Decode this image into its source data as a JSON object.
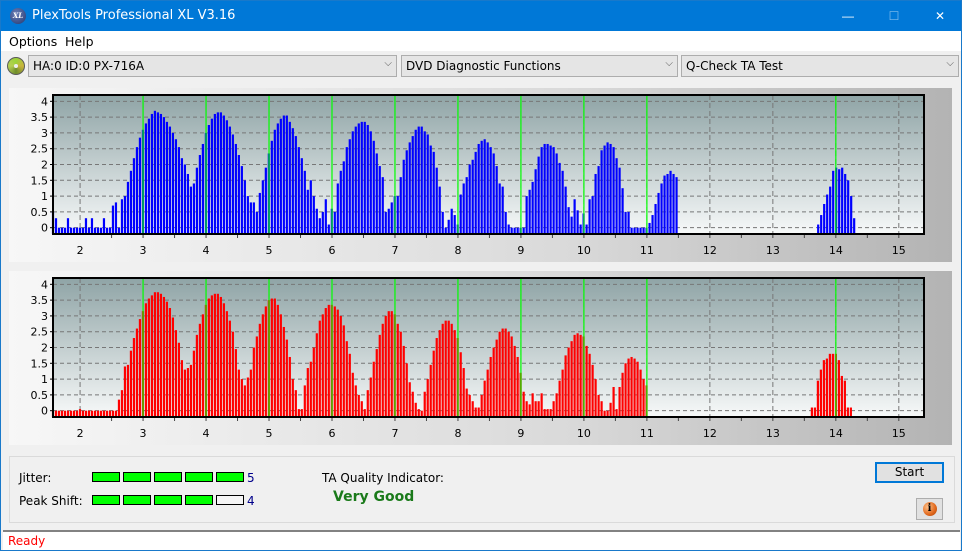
{
  "window": {
    "title": "PlexTools Professional XL V3.16",
    "app_icon_text": "XL",
    "controls": {
      "minimize": "—",
      "maximize": "☐",
      "close": "✕"
    }
  },
  "menu": {
    "items": [
      "Options",
      "Help"
    ]
  },
  "toolbar": {
    "drive": "HA:0 ID:0  PX-716A",
    "function": "DVD Diagnostic Functions",
    "test": "Q-Check TA Test",
    "chevron": "⌵"
  },
  "colors": {
    "jitter_bar": "#0000ff",
    "peak_bar": "#ff0000",
    "marker": "#00ff00",
    "meter_on": "#00ff00",
    "quality": "#1a7a1a",
    "status": "#ff0000"
  },
  "chart_data": [
    {
      "type": "bar",
      "name": "top-chart",
      "title": "",
      "xlabel": "",
      "ylabel": "",
      "xlim": [
        1.57,
        15.4
      ],
      "ylim": [
        -0.2,
        4.2
      ],
      "x_ticks": [
        2,
        3,
        4,
        5,
        6,
        7,
        8,
        9,
        10,
        11,
        12,
        13,
        14,
        15
      ],
      "y_ticks": [
        0,
        0.5,
        1,
        1.5,
        2,
        2.5,
        3,
        3.5,
        4
      ],
      "y_tick_labels": [
        "0",
        "0.5",
        "1",
        "1.5",
        "2",
        "2.5",
        "3",
        "3.5",
        "4"
      ],
      "grid": true,
      "marker_lines_x": [
        3,
        4,
        5,
        6,
        7,
        8,
        9,
        10,
        11,
        14
      ],
      "bar_x_start": 1.57,
      "bar_x_step": 0.0476,
      "color": "#0000ff",
      "values": [
        0.5,
        0.3,
        0,
        0,
        0,
        0.3,
        0,
        0,
        0,
        0,
        0,
        0.3,
        0,
        0.3,
        0,
        0,
        0,
        0.3,
        0,
        0,
        0.7,
        0.8,
        0,
        0.9,
        1.0,
        1.45,
        1.8,
        2.2,
        2.55,
        2.85,
        3.1,
        3.3,
        3.45,
        3.6,
        3.7,
        3.65,
        3.6,
        3.5,
        3.35,
        3.2,
        3.0,
        2.8,
        2.55,
        2.2,
        2.0,
        1.7,
        1.3,
        1.4,
        1.9,
        2.3,
        2.65,
        3.0,
        3.25,
        3.45,
        3.6,
        3.65,
        3.65,
        3.55,
        3.4,
        3.2,
        2.95,
        2.65,
        2.3,
        1.95,
        1.5,
        1.0,
        0.8,
        0.8,
        0.5,
        1.1,
        1.5,
        1.9,
        2.35,
        2.75,
        3.1,
        3.3,
        3.45,
        3.55,
        3.55,
        3.35,
        3.15,
        2.9,
        2.55,
        2.2,
        1.8,
        1.2,
        1.5,
        1.0,
        0.6,
        0.3,
        0.5,
        0.9,
        0.1,
        0.6,
        0.5,
        1.4,
        1.8,
        2.1,
        2.55,
        2.8,
        3.05,
        3.2,
        3.3,
        3.35,
        3.35,
        3.25,
        3.05,
        2.75,
        2.35,
        1.95,
        1.6,
        0.5,
        0.6,
        0.8,
        1.0,
        1.0,
        1.6,
        2.15,
        2.45,
        2.7,
        2.9,
        3.1,
        3.2,
        3.2,
        3.05,
        2.95,
        2.6,
        2.4,
        1.9,
        1.3,
        0.5,
        0,
        0.25,
        0.6,
        0.4,
        0.1,
        1.05,
        1.4,
        1.6,
        2.0,
        2.15,
        2.4,
        2.65,
        2.75,
        2.8,
        2.7,
        2.55,
        2.35,
        1.95,
        1.4,
        1.3,
        0.5,
        0.1,
        0,
        0,
        0,
        0,
        0,
        1.0,
        1.2,
        1.45,
        1.85,
        2.25,
        2.55,
        2.65,
        2.65,
        2.6,
        2.55,
        2.35,
        2.05,
        1.8,
        1.3,
        0.65,
        0.35,
        0.9,
        0.55,
        0.1,
        0.45,
        0.1,
        0.9,
        1.0,
        1.7,
        1.95,
        2.45,
        2.6,
        2.7,
        2.65,
        2.55,
        2.2,
        1.9,
        1.25,
        0.5,
        0.5,
        0,
        0,
        0,
        0,
        0,
        0,
        0.15,
        0.4,
        0.75,
        1.1,
        1.4,
        1.65,
        1.7,
        1.8,
        1.7,
        1.6,
        1.4,
        0.7,
        0.1
      ]
    },
    {
      "type": "bar",
      "name": "bottom-chart",
      "title": "",
      "xlabel": "",
      "ylabel": "",
      "xlim": [
        1.57,
        15.4
      ],
      "ylim": [
        -0.2,
        4.2
      ],
      "x_ticks": [
        2,
        3,
        4,
        5,
        6,
        7,
        8,
        9,
        10,
        11,
        12,
        13,
        14,
        15
      ],
      "y_ticks": [
        0,
        0.5,
        1,
        1.5,
        2,
        2.5,
        3,
        3.5,
        4
      ],
      "y_tick_labels": [
        "0",
        "0.5",
        "1",
        "1.5",
        "2",
        "2.5",
        "3",
        "3.5",
        "4"
      ],
      "grid": true,
      "marker_lines_x": [
        3,
        4,
        5,
        6,
        7,
        8,
        9,
        10,
        11,
        14
      ],
      "bar_x_start": 1.57,
      "bar_x_step": 0.0476,
      "color": "#ff0000",
      "values": [
        0,
        0,
        0,
        0,
        0,
        0,
        0,
        0,
        0,
        0.05,
        0,
        0,
        0,
        0,
        0,
        0,
        0,
        0,
        0,
        0,
        0,
        0,
        0.35,
        0.65,
        1.4,
        1.45,
        1.9,
        2.3,
        2.6,
        2.9,
        3.15,
        3.4,
        3.55,
        3.65,
        3.75,
        3.75,
        3.7,
        3.6,
        3.45,
        3.25,
        2.95,
        2.55,
        2.15,
        1.6,
        1.3,
        1.35,
        1.45,
        1.9,
        2.4,
        2.75,
        3.05,
        3.35,
        3.55,
        3.65,
        3.7,
        3.7,
        3.6,
        3.4,
        3.15,
        2.85,
        2.5,
        1.95,
        1.3,
        1.0,
        0.8,
        1.05,
        1.3,
        2.0,
        2.35,
        2.75,
        3.05,
        3.3,
        3.5,
        3.55,
        3.55,
        3.35,
        3.05,
        2.65,
        2.25,
        1.7,
        1.0,
        0.65,
        0.05,
        0.05,
        0.8,
        1.35,
        1.55,
        2.0,
        2.45,
        2.85,
        3.05,
        3.25,
        3.35,
        3.35,
        3.3,
        3.2,
        3.0,
        2.7,
        2.2,
        1.8,
        1.2,
        0.8,
        0.5,
        0.3,
        0.05,
        0.65,
        1.05,
        1.55,
        1.95,
        2.4,
        2.75,
        3.0,
        3.15,
        3.15,
        3.05,
        2.75,
        2.5,
        2.05,
        1.5,
        0.9,
        0.6,
        0.25,
        0.05,
        0,
        0.6,
        1.0,
        1.45,
        1.9,
        2.3,
        2.55,
        2.75,
        2.85,
        2.85,
        2.75,
        2.55,
        2.3,
        1.85,
        1.35,
        0.7,
        0.5,
        0.3,
        0.1,
        0.1,
        0.5,
        0.95,
        1.3,
        1.7,
        2.0,
        2.25,
        2.5,
        2.6,
        2.6,
        2.5,
        2.35,
        2.05,
        1.7,
        1.2,
        0.6,
        0.3,
        0.2,
        0.55,
        0.3,
        0.3,
        0.55,
        0.05,
        0.05,
        0.05,
        0.3,
        0.55,
        0.95,
        1.3,
        1.75,
        2.0,
        2.2,
        2.4,
        2.45,
        2.4,
        2.35,
        2.05,
        1.8,
        1.45,
        1.0,
        0.5,
        0.3,
        0,
        0,
        0.25,
        0.75,
        0.05,
        0.75,
        1.2,
        1.5,
        1.65,
        1.7,
        1.65,
        1.55,
        1.3,
        1.0,
        0.8
      ]
    }
  ],
  "chart_tail": {
    "top_peak14": {
      "x_start": 13.72,
      "values": [
        0.1,
        0.4,
        0.75,
        1.05,
        1.3,
        1.8,
        1.9,
        1.85,
        1.9,
        1.7,
        1.5,
        1.0,
        0.3
      ]
    },
    "bottom_peak14": {
      "x_start": 13.62,
      "values": [
        0.1,
        0.1,
        0.95,
        1.3,
        1.6,
        1.65,
        1.8,
        1.8,
        1.8,
        1.6,
        1.1,
        0.95,
        0.1,
        0.1
      ]
    }
  },
  "metrics": {
    "jitter_label": "Jitter:",
    "jitter_value": 5,
    "jitter_max": 5,
    "peak_shift_label": "Peak Shift:",
    "peak_shift_value": 4,
    "peak_shift_max": 5,
    "ta_quality_label": "TA Quality Indicator:",
    "ta_quality_value": "Very Good"
  },
  "buttons": {
    "start": "Start",
    "info": "i"
  },
  "status": {
    "text": "Ready"
  }
}
